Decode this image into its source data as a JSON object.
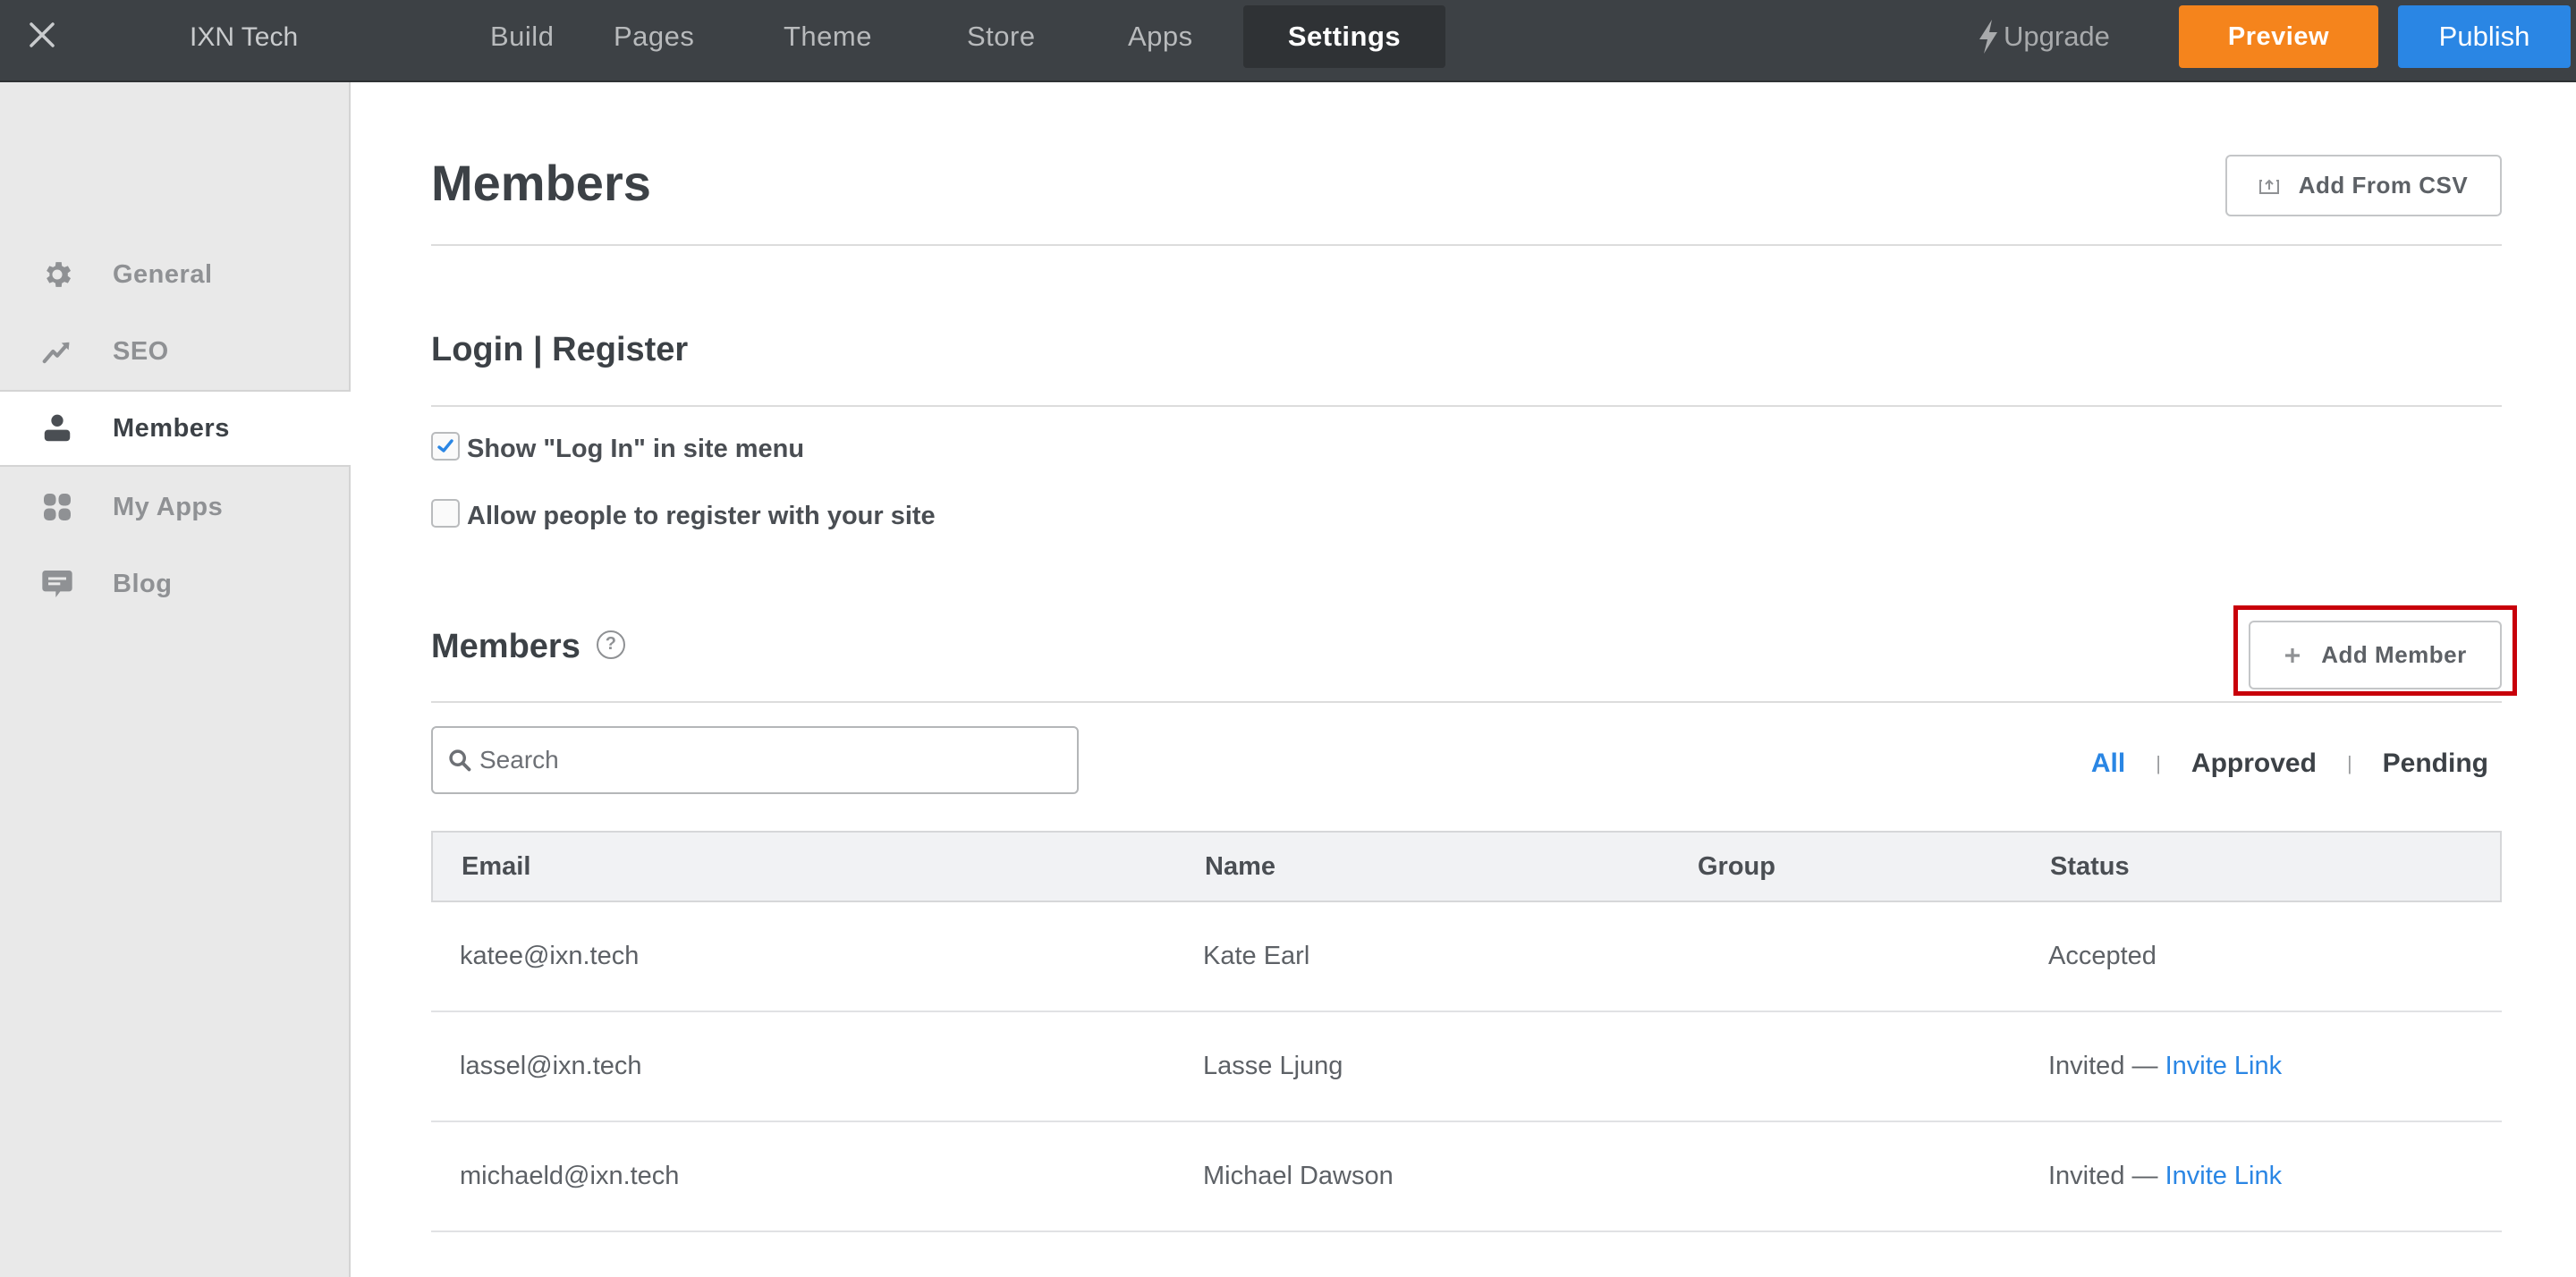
{
  "topbar": {
    "site_name": "IXN Tech",
    "nav": [
      {
        "label": "Build",
        "active": false
      },
      {
        "label": "Pages",
        "active": false
      },
      {
        "label": "Theme",
        "active": false
      },
      {
        "label": "Store",
        "active": false
      },
      {
        "label": "Apps",
        "active": false
      },
      {
        "label": "Settings",
        "active": true
      }
    ],
    "upgrade_label": "Upgrade",
    "preview_label": "Preview",
    "publish_label": "Publish",
    "colors": {
      "preview": "#f5841c",
      "publish": "#2a86e4",
      "bar": "#3d4145"
    }
  },
  "sidebar": {
    "items": [
      {
        "label": "General",
        "icon": "gear-icon",
        "active": false
      },
      {
        "label": "SEO",
        "icon": "trend-up-icon",
        "active": false
      },
      {
        "label": "Members",
        "icon": "user-icon",
        "active": true
      },
      {
        "label": "My Apps",
        "icon": "apps-grid-icon",
        "active": false
      },
      {
        "label": "Blog",
        "icon": "comment-icon",
        "active": false
      }
    ]
  },
  "page": {
    "title": "Members",
    "add_csv_label": "Add From CSV",
    "login_section": {
      "title": "Login | Register",
      "options": [
        {
          "label": "Show \"Log In\" in site menu",
          "checked": true
        },
        {
          "label": "Allow people to register with your site",
          "checked": false
        }
      ]
    },
    "members_section": {
      "title": "Members",
      "help_glyph": "?",
      "add_member_label": "Add Member",
      "search": {
        "placeholder": "Search",
        "value": ""
      },
      "filters": [
        {
          "label": "All",
          "active": true
        },
        {
          "label": "Approved",
          "active": false
        },
        {
          "label": "Pending",
          "active": false
        }
      ],
      "filter_separator": "|",
      "table": {
        "columns": [
          "Email",
          "Name",
          "Group",
          "Status"
        ],
        "rows": [
          {
            "email": "katee@ixn.tech",
            "name": "Kate Earl",
            "group": "",
            "status": "Accepted",
            "status_link": ""
          },
          {
            "email": "lassel@ixn.tech",
            "name": "Lasse Ljung",
            "group": "",
            "status": "Invited — ",
            "status_link": "Invite Link"
          },
          {
            "email": "michaeld@ixn.tech",
            "name": "Michael Dawson",
            "group": "",
            "status": "Invited — ",
            "status_link": "Invite Link"
          }
        ]
      }
    },
    "highlight_color": "#c8000a",
    "link_color": "#2a86e4"
  }
}
